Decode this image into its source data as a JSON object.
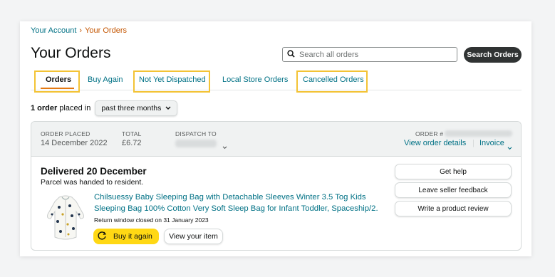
{
  "breadcrumb": {
    "parent": "Your Account",
    "separator": "›",
    "current": "Your Orders"
  },
  "page_title": "Your Orders",
  "search": {
    "placeholder": "Search all orders",
    "button_label": "Search Orders"
  },
  "tabs": [
    {
      "label": "Orders",
      "active": true
    },
    {
      "label": "Buy Again",
      "active": false
    },
    {
      "label": "Not Yet Dispatched",
      "active": false
    },
    {
      "label": "Local Store Orders",
      "active": false
    },
    {
      "label": "Cancelled Orders",
      "active": false
    }
  ],
  "filter": {
    "count_bold": "1 order",
    "suffix": "placed in",
    "selected": "past three months"
  },
  "order": {
    "placed_label": "ORDER PLACED",
    "placed_value": "14 December 2022",
    "total_label": "TOTAL",
    "total_value": "£6.72",
    "dispatch_label": "DISPATCH TO",
    "order_label": "ORDER #",
    "view_details": "View order details",
    "separator": "|",
    "invoice": "Invoice",
    "status": "Delivered 20 December",
    "status_note": "Parcel was handed to resident.",
    "product_title": "Chilsuessy Baby Sleeping Bag with Detachable Sleeves Winter 3.5 Tog Kids Sleeping Bag 100% Cotton Very Soft Sleep Bag for Infant Toddler, Spaceship/2.",
    "return_window": "Return window closed on 31 January 2023",
    "buy_again": "Buy it again",
    "view_item": "View your item",
    "side_buttons": [
      "Get help",
      "Leave seller feedback",
      "Write a product review"
    ]
  },
  "colors": {
    "link": "#007185",
    "accent_orange": "#c45500",
    "buy_yellow": "#ffd814",
    "highlight": "#f3c335",
    "dark_button": "#303333"
  }
}
